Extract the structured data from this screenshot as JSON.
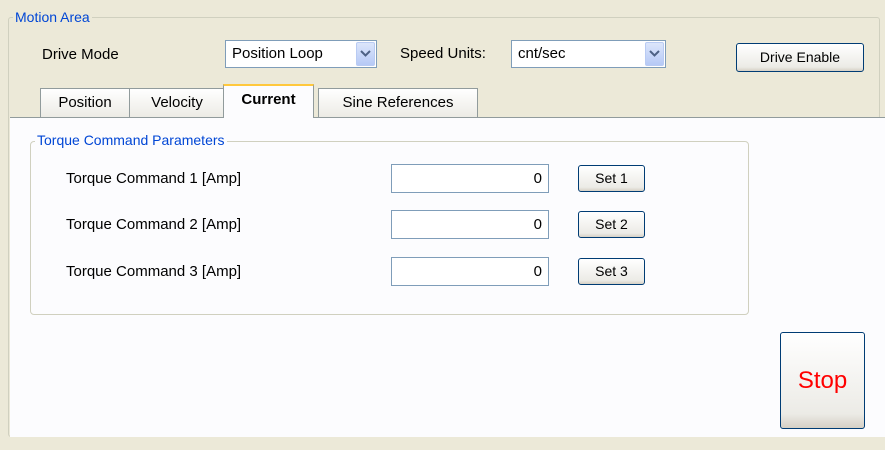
{
  "motion_area": {
    "legend": "Motion Area",
    "drive_mode_label": "Drive Mode",
    "drive_mode_value": "Position Loop",
    "speed_units_label": "Speed Units:",
    "speed_units_value": "cnt/sec",
    "drive_enable_label": "Drive Enable"
  },
  "tabs": [
    {
      "label": "Position",
      "active": false
    },
    {
      "label": "Velocity",
      "active": false
    },
    {
      "label": "Current",
      "active": true
    },
    {
      "label": "Sine References",
      "active": false
    }
  ],
  "torque": {
    "legend": "Torque Command  Parameters",
    "rows": [
      {
        "label": "Torque Command 1 [Amp]",
        "value": "0",
        "button": "Set 1"
      },
      {
        "label": "Torque Command  2 [Amp]",
        "value": "0",
        "button": "Set 2"
      },
      {
        "label": "Torque Command 3 [Amp]",
        "value": "0",
        "button": "Set 3"
      }
    ]
  },
  "stop_label": "Stop",
  "colors": {
    "stop_text": "#FF0000",
    "legend_text": "#0046D5",
    "active_tab_accent": "#FFC83C"
  }
}
